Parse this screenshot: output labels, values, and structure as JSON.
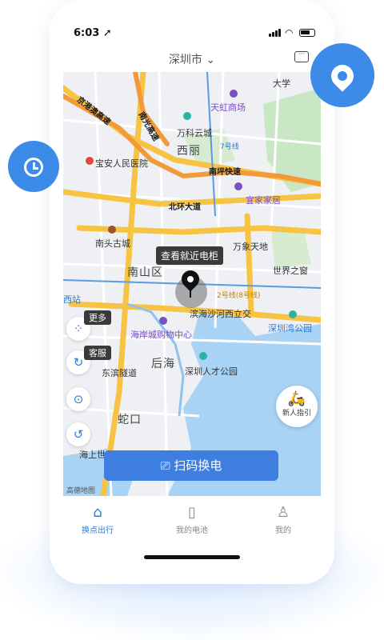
{
  "status": {
    "time": "6:03 ➚"
  },
  "header": {
    "city": "深圳市 ⌄",
    "chat_icon": "chat-icon"
  },
  "map": {
    "tooltip": "查看就近电柜",
    "labels": {
      "daxue": "大学",
      "tianhong": "天虹商场",
      "wanke": "万科云城",
      "xili": "西丽",
      "baoan_hospital": "宝安人民医院",
      "nanping": "南坪快速",
      "beihuan": "北环大道",
      "yijia": "宜家家居",
      "nantou": "南头古城",
      "wanxiang": "万象天地",
      "nanshan": "南山区",
      "world": "世界之窗",
      "binhai": "滨海沙河西立交",
      "haian": "海岸城购物中心",
      "houhai": "后海",
      "shenzhenwan_park": "深圳湾公园",
      "dongbin": "东滨隧道",
      "talent_park": "深圳人才公园",
      "shekou": "蛇口",
      "haishangshijie": "海上世界",
      "xixiang": "西站",
      "road_jingguang": "京港澳高速",
      "road_nanguang": "南光高速",
      "road_nanpingroad": "南坪快速",
      "road_7": "7号线",
      "road_2": "2号线(8号线)",
      "amap": "高德地图"
    }
  },
  "side_buttons": {
    "more_label": "更多",
    "service_label": "客服"
  },
  "guide": {
    "label": "新人指引"
  },
  "scan_button": {
    "label": "扫码换电"
  },
  "tabs": [
    {
      "label": "换点出行"
    },
    {
      "label": "我的电池"
    },
    {
      "label": "我的"
    }
  ],
  "colors": {
    "accent": "#3d7ee0",
    "road": "#f6c343",
    "water": "#a9d3f5",
    "green": "#c9e7c4"
  }
}
